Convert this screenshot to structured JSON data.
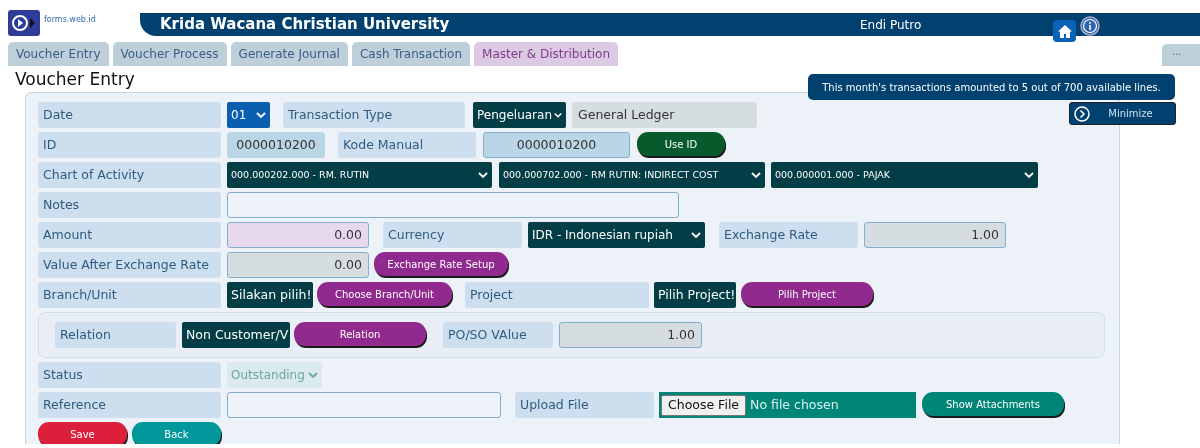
{
  "header": {
    "logo_text": "forms.web.id",
    "title": "Krida Wacana Christian University",
    "user": "Endi Putro"
  },
  "tabs": [
    {
      "label": "Voucher Entry",
      "selected": false,
      "color": "#bdd0da"
    },
    {
      "label": "Voucher Process",
      "selected": false,
      "color": "#bdd0da"
    },
    {
      "label": "Generate Journal",
      "selected": false,
      "color": "#bdd0da"
    },
    {
      "label": "Cash Transaction",
      "selected": false,
      "color": "#bdd0da"
    },
    {
      "label": "Master & Distribution",
      "selected": false,
      "color": "#dcc9e4"
    }
  ],
  "overflow_tab": {
    "label": "..."
  },
  "page_title": "Voucher Entry",
  "notice": "This month's transactions amounted to 5 out of 700 available lines.",
  "minimize_button": "Minimize",
  "form": {
    "rows": [
      {
        "boxed": false,
        "items": [
          {
            "kind": "label",
            "text": "Date"
          },
          {
            "kind": "select",
            "text": "01",
            "color": "#0b5fb0",
            "disabled": false
          },
          {
            "kind": "label",
            "text": "Transaction Type"
          },
          {
            "kind": "select",
            "text": "Pengeluaran",
            "color": "#033e47",
            "disabled": false
          },
          {
            "kind": "text-input",
            "value": "General Ledger",
            "color": "#d6dde1"
          }
        ]
      },
      {
        "boxed": false,
        "items": [
          {
            "kind": "id-box",
            "value": "0000010200"
          },
          {
            "kind": "label",
            "text": "Kode Manual"
          },
          {
            "kind": "code-input",
            "value": "0000010200",
            "color": "#bad5e6"
          },
          {
            "kind": "button",
            "text": "Use ID",
            "color": "#075a2b"
          }
        ],
        "label": "ID"
      },
      {
        "boxed": false,
        "items": [
          {
            "kind": "select",
            "text": "000.000202.000 - RM. RUTIN",
            "color": "#033e47",
            "disabled": false
          },
          {
            "kind": "select",
            "text": "000.000702.000 - RM RUTIN: INDIRECT COST",
            "color": "#033e47",
            "disabled": false
          },
          {
            "kind": "select",
            "text": "000.000001.000 - PAJAK",
            "color": "#033e47",
            "disabled": false
          }
        ],
        "label": "Chart of Activity"
      },
      {
        "boxed": false,
        "items": [
          {
            "kind": "text-input",
            "color": "#edf2f9"
          }
        ],
        "label": "Notes"
      },
      {
        "boxed": false,
        "items": [
          {
            "kind": "number-input",
            "value": "0.00",
            "color": "#e8d8ee"
          },
          {
            "kind": "label",
            "text": "Currency"
          },
          {
            "kind": "select",
            "text": "IDR - Indonesian rupiah",
            "color": "#033e47",
            "disabled": false
          },
          {
            "kind": "label",
            "text": "Exchange Rate"
          },
          {
            "kind": "number-input",
            "value": "1.00",
            "color": "#d6dde1"
          }
        ],
        "label": "Amount"
      },
      {
        "boxed": false,
        "items": [
          {
            "kind": "number-input",
            "value": "0.00",
            "color": "#d6dde1"
          },
          {
            "kind": "button",
            "text": "Exchange Rate Setup",
            "color": "#912a8e"
          }
        ],
        "label": "Value After Exchange Rate"
      },
      {
        "boxed": false,
        "items": [
          {
            "kind": "picker-value",
            "text": "Silakan pilih!"
          },
          {
            "kind": "button",
            "text": "Choose Branch/Unit",
            "color": "#912a8e"
          },
          {
            "kind": "label",
            "text": "Project"
          },
          {
            "kind": "picker-value",
            "text": "Pilih Project!"
          },
          {
            "kind": "button",
            "text": "Pilih Project",
            "color": "#912a8e"
          }
        ],
        "label": "Branch/Unit"
      },
      {
        "boxed": true,
        "items": [
          {
            "kind": "label",
            "text": "Relation"
          },
          {
            "kind": "picker-value",
            "text": "Non Customer/V"
          },
          {
            "kind": "button",
            "text": "Relation",
            "color": "#912a8e"
          },
          {
            "kind": "label",
            "text": "PO/SO VAlue"
          },
          {
            "kind": "number-input",
            "value": "1.00",
            "color": "#d6dde1"
          }
        ]
      },
      {
        "boxed": false,
        "items": [
          {
            "kind": "select",
            "text": "Outstanding",
            "color": "#dbeaed",
            "disabled": true
          }
        ],
        "label": "Status"
      },
      {
        "boxed": false,
        "items": [
          {
            "kind": "text-input",
            "color": "#edf2f9"
          },
          {
            "kind": "label",
            "text": "Upload File"
          },
          {
            "kind": "file",
            "button": "Choose File",
            "text": "No file chosen"
          },
          {
            "kind": "button",
            "text": "Show Attachments",
            "color": "#008577"
          }
        ],
        "label": "Reference"
      },
      {
        "boxed": false,
        "items": [
          {
            "kind": "button",
            "text": "Save",
            "color": "#dc1f3b"
          },
          {
            "kind": "button",
            "text": "Back",
            "color": "#00989a"
          }
        ]
      }
    ]
  }
}
